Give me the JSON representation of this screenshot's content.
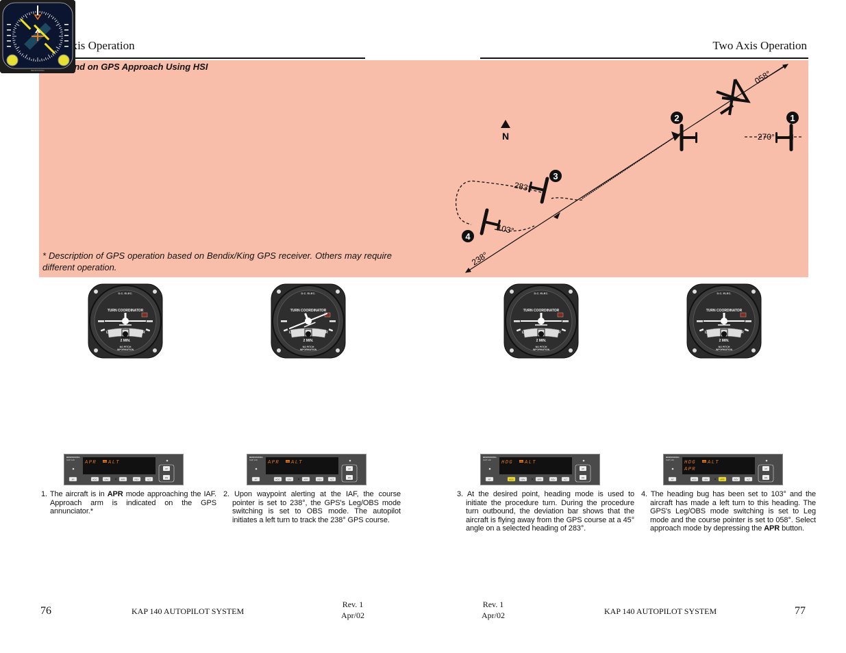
{
  "header": {
    "left_title": "Two Axis Operation",
    "right_title": "Two Axis Operation"
  },
  "banner": {
    "section_title": "Outbound on GPS Approach Using HSI",
    "footnote": "* Description of GPS operation based on Bendix/King GPS receiver. Others may require different operation.",
    "color": "#f9bea9"
  },
  "diagram": {
    "north_label": "N",
    "headings": {
      "h058": "058°",
      "h270": "270°",
      "h283": "283°",
      "h103": "103°",
      "h238": "238°"
    },
    "markers": [
      "1",
      "2",
      "3",
      "4"
    ]
  },
  "turn_coordinator": {
    "top_label": "D.C. ELEC.",
    "title": "TURN COORDINATOR",
    "left": "L",
    "right": "R",
    "rate": "2 MIN.",
    "note_line1": "NO PITCH",
    "note_line2": "INFORMATION"
  },
  "hsi": {
    "brand": "BENDIX/KING"
  },
  "autopilot": {
    "brand_line1": "BENDIX/KING",
    "brand_line2": "KAP 140",
    "buttons": [
      "AP",
      "HDG",
      "NAV",
      "APR",
      "REV",
      "ALT"
    ],
    "up": "UP",
    "dn": "DN",
    "panels": [
      {
        "line1_mode": "APR",
        "arm": "ARM",
        "line1_alt": "ALT",
        "line2": "",
        "active_button": ""
      },
      {
        "line1_mode": "APR",
        "arm": "ARM",
        "line1_alt": "ALT",
        "line2": "",
        "active_button": ""
      },
      {
        "line1_mode": "HDG",
        "arm": "ARM",
        "line1_alt": "ALT",
        "line2": "",
        "active_button": "HDG"
      },
      {
        "line1_mode": "HDG",
        "arm": "ARM",
        "line1_alt": "ALT",
        "line2": "APR",
        "active_button": "APR"
      }
    ]
  },
  "steps": [
    {
      "num": "1.",
      "pre": "The aircraft is in ",
      "bold": "APR",
      "post": " mode approaching the IAF. Approach arm is indicated on the GPS annunciator.*"
    },
    {
      "num": "2.",
      "pre": "Upon waypoint alerting at the IAF, the course pointer is set to 238°, the GPS's Leg/OBS mode switching is set to OBS mode. The autopilot initiates a left turn to track the 238° GPS course.",
      "bold": "",
      "post": ""
    },
    {
      "num": "3.",
      "pre": "At the desired point, heading mode is used to initiate the procedure turn. During the procedure turn outbound, the deviation bar shows that the aircraft is flying away from the GPS course at a 45° angle on a selected heading of 283°.",
      "bold": "",
      "post": ""
    },
    {
      "num": "4.",
      "pre": "The heading bug has been set to 103° and the aircraft has made a left turn to this heading. The GPS's Leg/OBS mode switching is set to Leg mode and the course pointer is set to 058°. Select approach mode by depressing the ",
      "bold": "APR",
      "post": " button."
    }
  ],
  "footer": {
    "left_page": "76",
    "right_page": "77",
    "system": "KAP 140 AUTOPILOT SYSTEM",
    "rev": "Rev. 1",
    "date": "Apr/02"
  }
}
